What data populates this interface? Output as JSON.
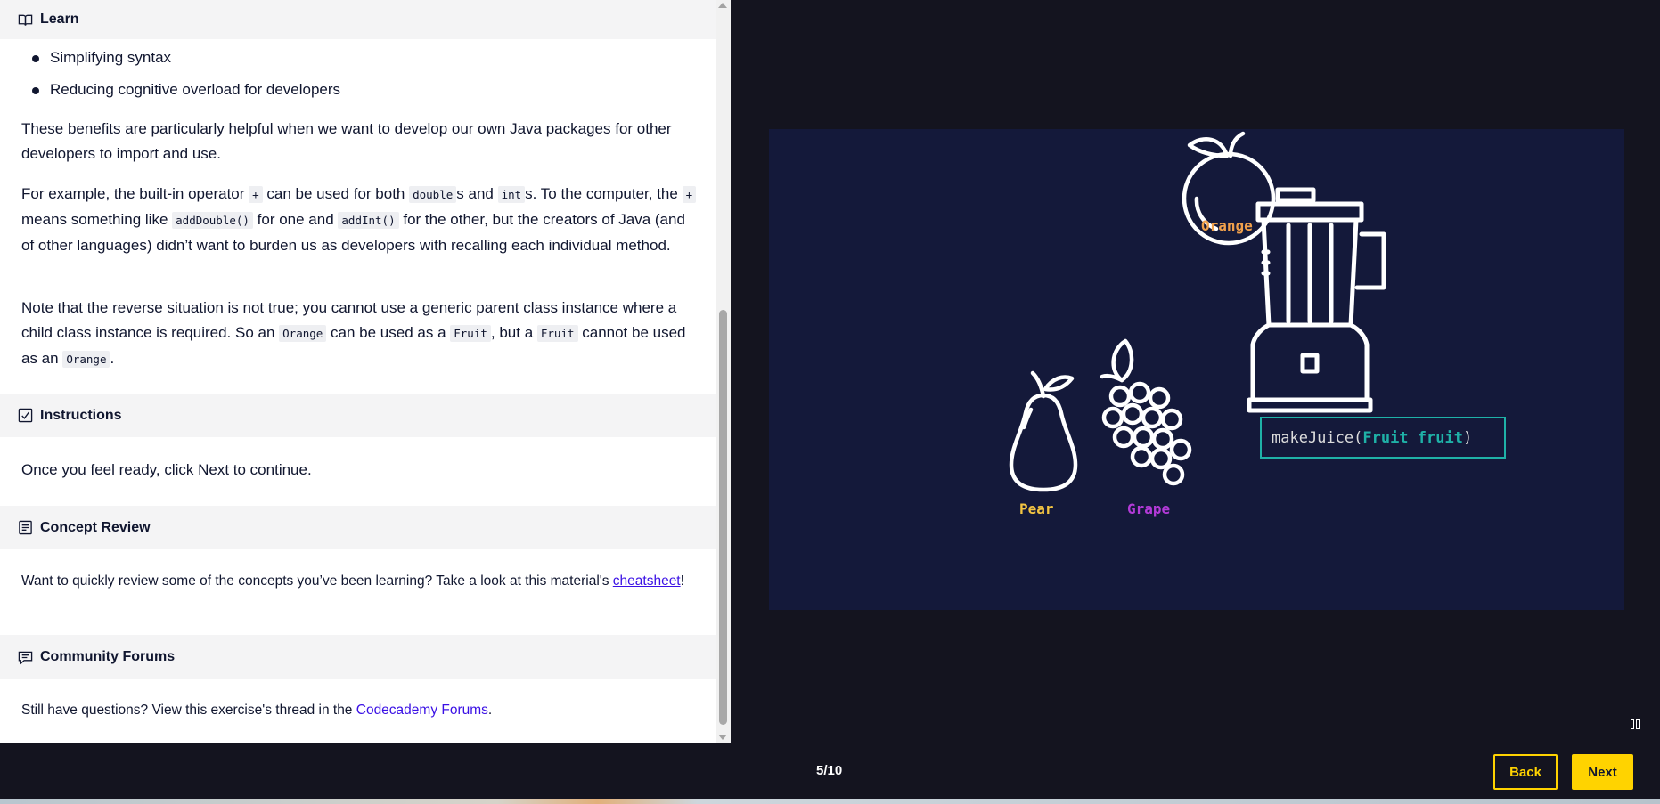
{
  "lesson": {
    "learn_header": "Learn",
    "bullets": [
      "Simplifying syntax",
      "Reducing cognitive overload for developers"
    ],
    "paragraph1": "These benefits are particularly helpful when we want to develop our own Java packages for other developers to import and use.",
    "paragraph2": {
      "t1": "For example, the built-in operator ",
      "c1": "+",
      "t2": " can be used for both ",
      "c2": "double",
      "t3": "s and ",
      "c3": "int",
      "t4": "s. To the computer, the ",
      "c4": "+",
      "t5": " means something like ",
      "c5": "addDouble()",
      "t6": " for one and ",
      "c6": "addInt()",
      "t7": " for the other, but the creators of Java (and of other languages) didn’t want to burden us as developers with recalling each individual method."
    },
    "paragraph3": {
      "t1": "Note that the reverse situation is not true; you cannot use a generic parent class instance where a child class instance is required. So an ",
      "c1": "Orange",
      "t2": " can be used as a ",
      "c2": "Fruit",
      "t3": ", but a ",
      "c3": "Fruit",
      "t4": " cannot be used as an ",
      "c4": "Orange",
      "t5": "."
    },
    "instructions_header": "Instructions",
    "instructions_text": "Once you feel ready, click Next to continue.",
    "concept_header": "Concept Review",
    "concept_text": "Want to quickly review some of the concepts you’ve been learning? Take a look at this material's ",
    "concept_link": "cheatsheet",
    "concept_end": "!",
    "forums_header": "Community Forums",
    "forums_text": "Still have questions? View this exercise's thread in the ",
    "forums_link": "Codecademy Forums",
    "forums_end": "."
  },
  "diagram": {
    "orange_label": "Orange",
    "pear_label": "Pear",
    "grape_label": "Grape",
    "method_name": "makeJuice(",
    "method_arg": "Fruit fruit",
    "method_close": ")",
    "colors": {
      "background": "#14193a",
      "orange": "#f0a04b",
      "pear": "#f4c542",
      "grape": "#b33ad8",
      "teal": "#1fb1a7"
    }
  },
  "footer": {
    "progress": "5/10",
    "back_label": "Back",
    "next_label": "Next"
  },
  "icons": {
    "learn": "book-icon",
    "instructions": "checkbox-icon",
    "concept": "document-icon",
    "forums": "chat-icon",
    "pause": "pause-icon"
  }
}
